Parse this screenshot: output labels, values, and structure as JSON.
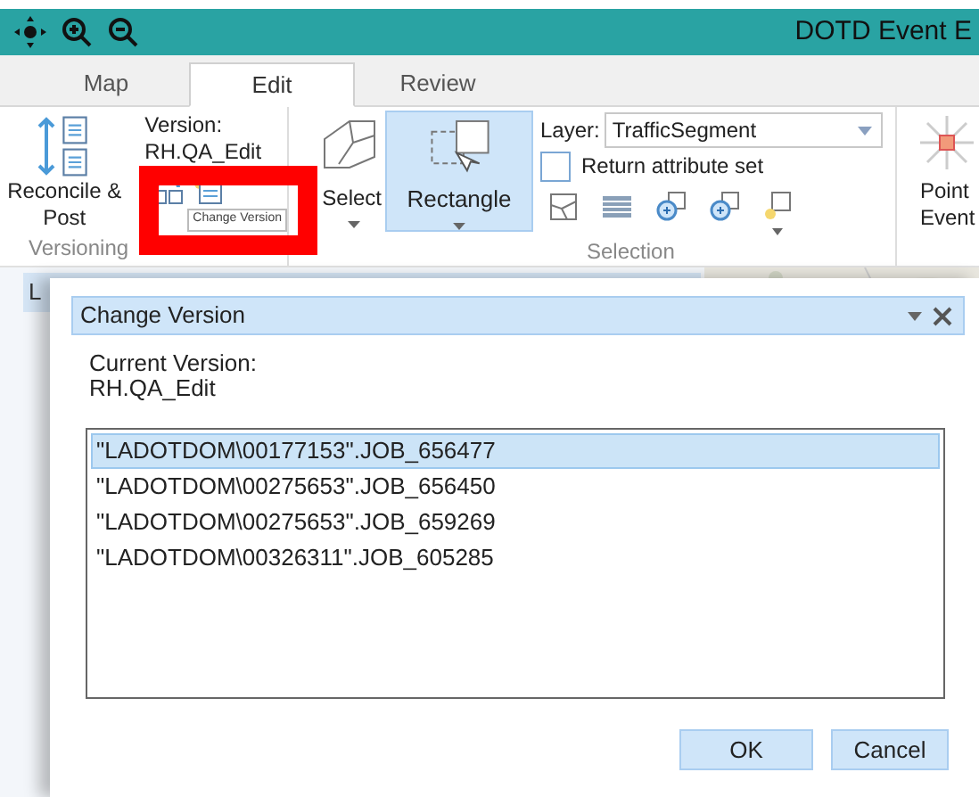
{
  "window": {
    "title": "DOTD Event E"
  },
  "tabs": [
    {
      "label": "Map",
      "selected": false
    },
    {
      "label": "Edit",
      "selected": true
    },
    {
      "label": "Review",
      "selected": false
    }
  ],
  "ribbon": {
    "versioning": {
      "reconcile_button": "Reconcile & Post",
      "version_label": "Version:",
      "version_value": "RH.QA_Edit",
      "tooltip": "Change Version",
      "group_label": "Versioning"
    },
    "selection": {
      "select_button": "Select",
      "rectangle_button": {
        "label": "Rectangle",
        "selected": true
      },
      "layer_label": "Layer:",
      "layer_value": "TrafficSegment",
      "return_attribute_set": {
        "label": "Return attribute set",
        "checked": false
      },
      "group_label": "Selection"
    },
    "point_event_button": "Point Event"
  },
  "side_panel": {
    "tab": "L"
  },
  "dialog": {
    "title": "Change Version",
    "current_version_label": "Current Version:",
    "current_version": "RH.QA_Edit",
    "versions": [
      {
        "label": "\"LADOTDOM\\00177153\".JOB_656477",
        "selected": true
      },
      {
        "label": "\"LADOTDOM\\00275653\".JOB_656450",
        "selected": false
      },
      {
        "label": "\"LADOTDOM\\00275653\".JOB_659269",
        "selected": false
      },
      {
        "label": "\"LADOTDOM\\00326311\".JOB_605285",
        "selected": false
      }
    ],
    "buttons": [
      "OK",
      "Cancel"
    ]
  }
}
